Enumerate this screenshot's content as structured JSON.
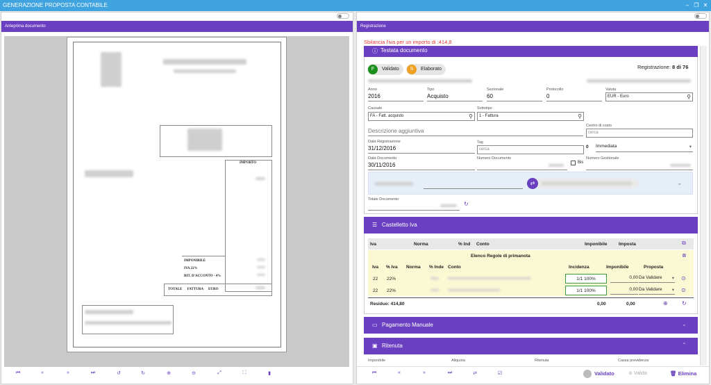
{
  "window": {
    "title": "GENERAZIONE PROPOSTA CONTABILE",
    "min": "–",
    "restore": "❐",
    "close": "✕"
  },
  "left": {
    "header": "Anteprima documento"
  },
  "invoice": {
    "importo": "IMPORTO",
    "imponibile": "IMPONIBILE",
    "iva": "IVA 22%",
    "rit": "RIT. D'ACCONTO - 4%",
    "totale": "TOTALE FATTURA EURO"
  },
  "right": {
    "header": "Registrazione",
    "warning": "Sbilancia l'iva per un importo di :414,8"
  },
  "testata": {
    "title": "Testata documento",
    "validato_badge": "Validato",
    "validato_letter": "F",
    "elaborato_badge": "Elaborato",
    "elaborato_letter": "S",
    "registrazione_label": "Registrazione:",
    "registrazione_value": "8 di 76",
    "anno_label": "Anno",
    "anno": "2016",
    "tipo_label": "Tipo",
    "tipo": "Acquisto",
    "sezionale_label": "Sezionale",
    "sezionale": "60",
    "protocollo_label": "Protocollo",
    "protocollo": "0",
    "valuta_label": "Valuta",
    "valuta": "EUR - Euro",
    "causale_label": "Causale",
    "causale": "FA - Fatt. acquisto",
    "sottotipo_label": "Sottotipo",
    "sottotipo": "1 - Fattura",
    "centro_label": "Centro di costo",
    "centro_ph": "cerca",
    "descrizione_ph": "Descrizione aggiuntiva",
    "data_reg_label": "Data Registrazione",
    "data_reg": "31/12/2016",
    "tag_label": "Tag",
    "tag_ph": "cerca",
    "immediata_num": "0",
    "immediata": "Immediata",
    "data_doc_label": "Data Documento",
    "data_doc": "30/11/2016",
    "num_doc_label": "Numero Documento",
    "bis_label": "Bis",
    "num_gest_label": "Numero Gestionale",
    "totale_doc_label": "Totale Documento"
  },
  "castelletto": {
    "title": "Castelletto Iva",
    "headers": [
      "Iva",
      "Norma",
      "% Ind",
      "Conto",
      "Imponibile",
      "Imposta"
    ],
    "elenco_title": "Elenco Regole di primanota",
    "sub_headers": [
      "Iva",
      "% Iva",
      "Norma",
      "% Inde",
      "Conto",
      "Incidenza",
      "Imponibile",
      "Proposta"
    ],
    "rows": [
      {
        "iva": "22",
        "piva": "22%",
        "incidenza": "1/1 100%",
        "imponibile": "0,00",
        "proposta": "Da Validare"
      },
      {
        "iva": "22",
        "piva": "22%",
        "incidenza": "1/1 100%",
        "imponibile": "0,00",
        "proposta": "Da Validare"
      }
    ],
    "residuo": "Residuo: 414,80",
    "tot_imponibile": "0,00",
    "tot_imposta": "0,00"
  },
  "pagamento": {
    "title": "Pagamento Manuale"
  },
  "ritenuta": {
    "title": "Ritenuta",
    "labels": [
      "Imponibile",
      "Aliquota",
      "Ritenuta",
      "Cassa previdenza"
    ]
  },
  "footer": {
    "validato": "Validato",
    "valida": "Valida",
    "elimina": "Elimina"
  }
}
